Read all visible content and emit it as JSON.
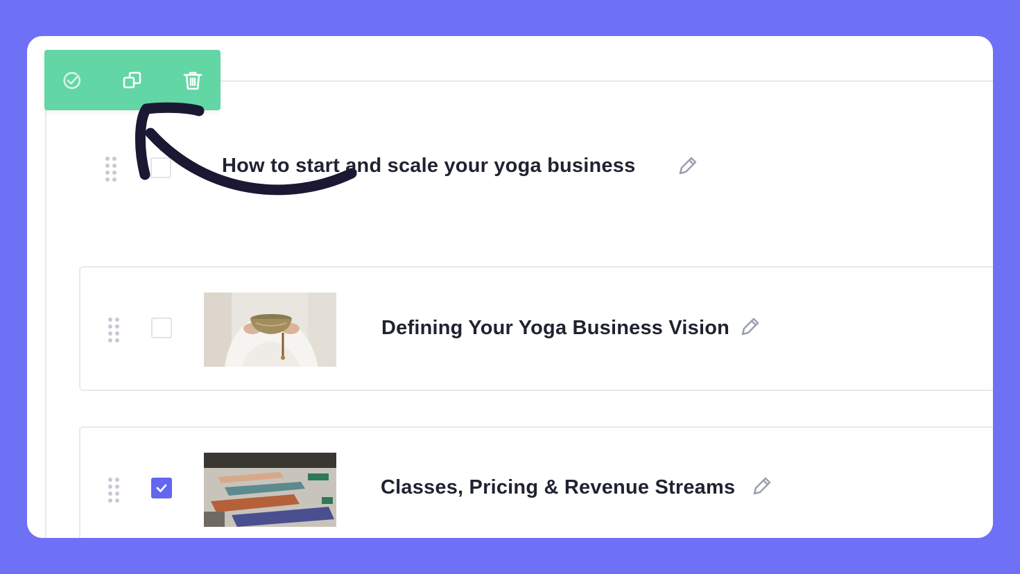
{
  "toolbar": {
    "actions": [
      {
        "icon": "check-circle-icon",
        "label": "Mark complete"
      },
      {
        "icon": "duplicate-icon",
        "label": "Duplicate"
      },
      {
        "icon": "trash-icon",
        "label": "Delete"
      }
    ]
  },
  "section": {
    "title": "How to start and scale your yoga business",
    "checked": false
  },
  "lessons": [
    {
      "title": "Defining Your Yoga Business Vision",
      "checked": false,
      "thumbnail": "singing-bowl-photo"
    },
    {
      "title": "Classes, Pricing & Revenue Streams",
      "checked": true,
      "thumbnail": "yoga-mats-photo"
    }
  ],
  "colors": {
    "background": "#6e70f5",
    "toolbar": "#62d6a5",
    "checkbox_checked": "#6366f1",
    "arrow": "#1a1833"
  }
}
